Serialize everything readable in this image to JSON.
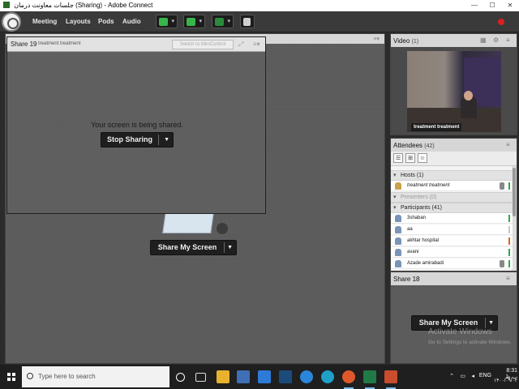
{
  "window": {
    "title": "جلسات معاونت درمان (Sharing) - Adobe Connect",
    "controls": [
      "—",
      "☐",
      "✕"
    ]
  },
  "menu": {
    "items": [
      "Meeting",
      "Layouts",
      "Pods",
      "Audio"
    ]
  },
  "main_share": {
    "button_label": "Share My Screen"
  },
  "share19": {
    "title": "Share 19",
    "presenter": "treatment treatment",
    "mini_control_label": "Switch to MiniControl",
    "message": "Your screen is being shared.",
    "stop_label": "Stop Sharing"
  },
  "video": {
    "title": "Video",
    "count": "(1)",
    "name_overlay": "treatment treatment"
  },
  "attendees": {
    "title": "Attendees",
    "count": "(42)",
    "hosts_label": "Hosts (1)",
    "host_name": "treatment treatment",
    "presenters_label": "Presenters (0)",
    "participants_label": "Participants (41)",
    "participants": [
      {
        "name": "3shaban",
        "status_color": "#2aa84a"
      },
      {
        "name": "aa",
        "status_color": "#c8c8c8"
      },
      {
        "name": "akhtar hospital",
        "status_color": "#e8601c"
      },
      {
        "name": "avani",
        "status_color": "#2aa84a"
      },
      {
        "name": "Azade amirabadi",
        "status_color": "#2aa84a"
      }
    ]
  },
  "share18": {
    "title": "Share 18",
    "button_label": "Share My Screen"
  },
  "watermark": {
    "line1": "Activate Windows",
    "line2": "Go to Settings to activate Windows."
  },
  "taskbar": {
    "search_placeholder": "Type here to search",
    "lang": "ENG",
    "time": "8:31 ب.ظ",
    "date": "۱۴۰۰/۰۹/۰۲"
  },
  "colors": {
    "accent_green": "#39b54a",
    "record_red": "#d92020",
    "taskbar_bg": "#1f1f1f"
  }
}
